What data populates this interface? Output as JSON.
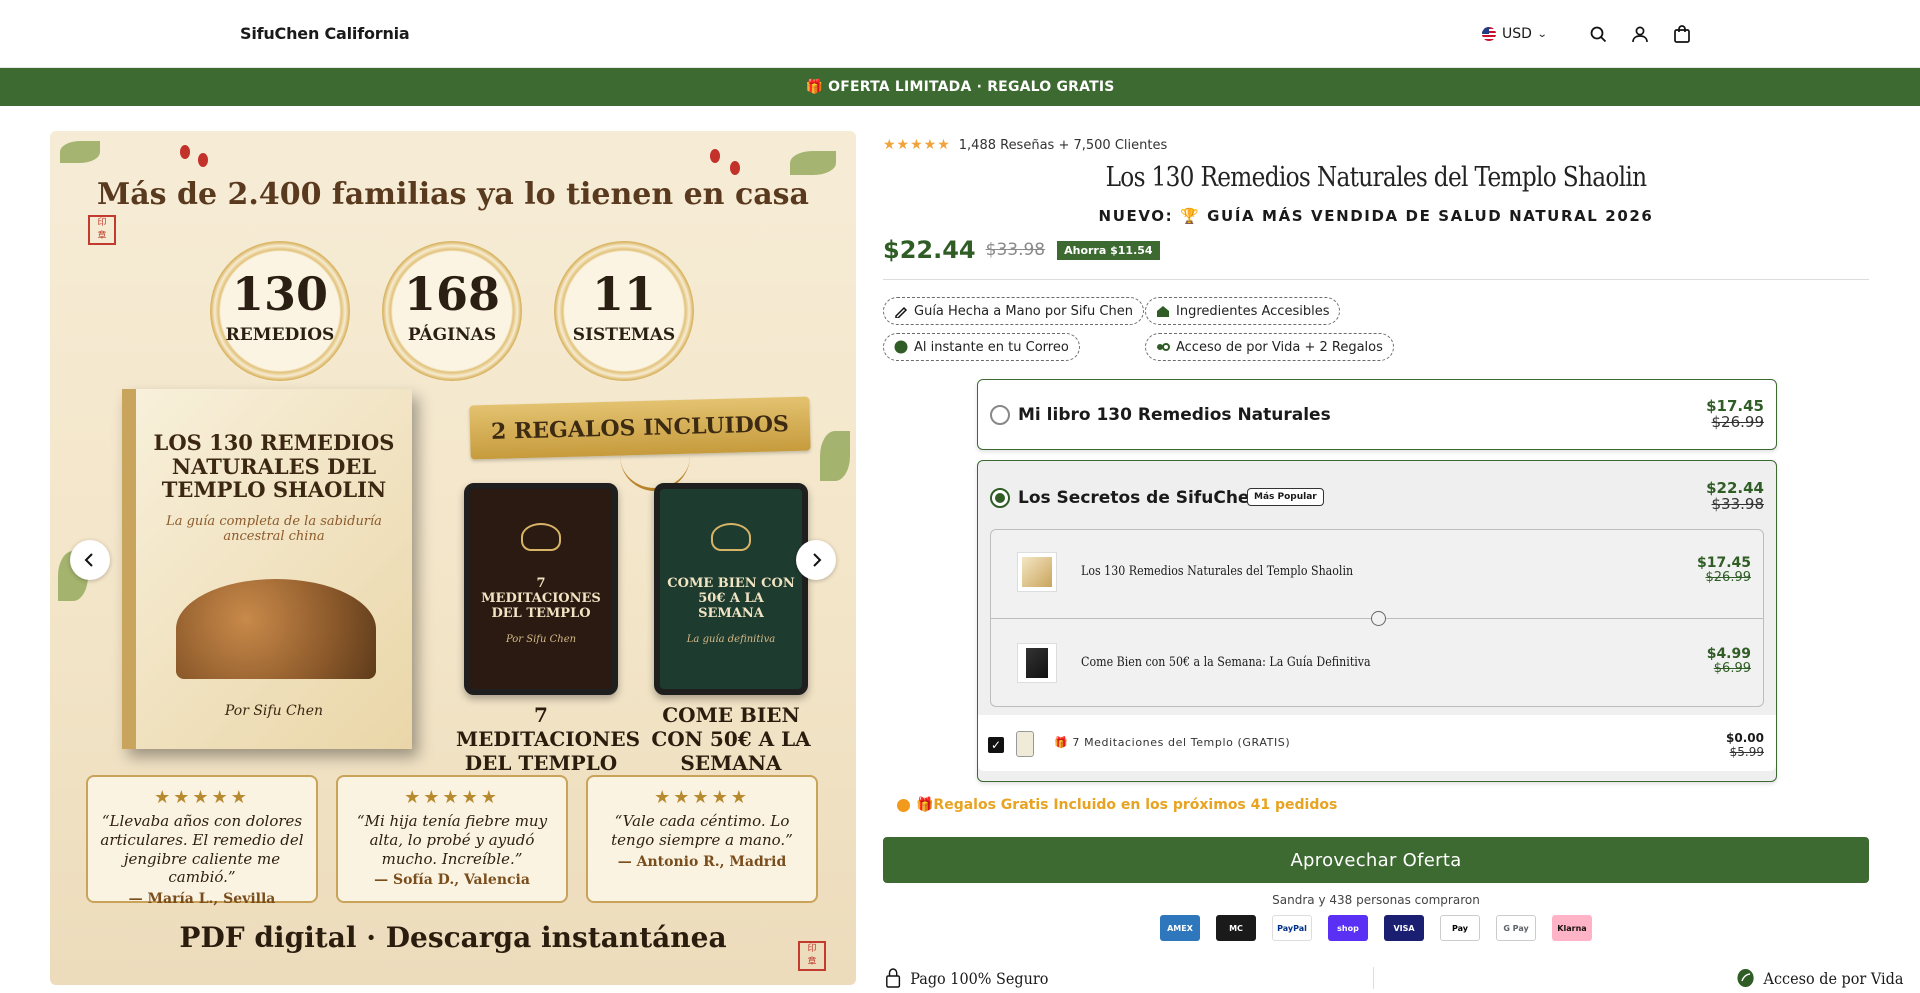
{
  "header": {
    "brand": "SifuChen California",
    "currency": "USD",
    "icons": [
      "flag-us-icon",
      "chevron-down-icon",
      "search-icon",
      "account-icon",
      "bag-icon"
    ]
  },
  "promo": {
    "text": "🎁 OFERTA LIMITADA · REGALO GRATIS"
  },
  "gallery": {
    "headline": "Más de 2.400 familias ya lo tienen en casa",
    "stats": [
      {
        "value": "130",
        "label": "REMEDIOS"
      },
      {
        "value": "168",
        "label": "PÁGINAS"
      },
      {
        "value": "11",
        "label": "SISTEMAS"
      }
    ],
    "ribbon": "2 REGALOS INCLUIDOS",
    "book": {
      "title": "LOS 130 REMEDIOS NATURALES DEL TEMPLO SHAOLIN",
      "subtitle": "La guía completa de la sabiduría ancestral china",
      "author": "Por Sifu Chen"
    },
    "bonus1": {
      "cover_title": "7 MEDITACIONES DEL TEMPLO",
      "cover_author": "Por Sifu Chen",
      "caption": "7 MEDITACIONES DEL TEMPLO"
    },
    "bonus2": {
      "cover_title": "COME BIEN CON 50€ A LA SEMANA",
      "cover_author": "La guía definitiva",
      "caption": "COME BIEN CON 50€ A LA SEMANA"
    },
    "reviews": [
      {
        "stars": "★★★★★",
        "quote": "“Llevaba años con dolores articulares. El remedio del jengibre caliente me cambió.”",
        "author": "— María L., Sevilla"
      },
      {
        "stars": "★★★★★",
        "quote": "“Mi hija tenía fiebre muy alta, lo probé y ayudó mucho. Increíble.”",
        "author": "— Sofía D., Valencia"
      },
      {
        "stars": "★★★★★",
        "quote": "“Vale cada céntimo. Lo tengo siempre a mano.”",
        "author": "— Antonio R., Madrid"
      }
    ],
    "footer": "PDF digital · Descarga instantánea",
    "prev": "‹",
    "next": "›"
  },
  "product": {
    "stars": "★★★★★",
    "rating_text": "1,488 Reseñas + 7,500 Clientes",
    "title": "Los 130 Remedios Naturales del Templo Shaolin",
    "subtitle": "NUEVO: 🏆 GUÍA MÁS VENDIDA DE SALUD NATURAL 2026",
    "price": "$22.44",
    "compare_price": "$33.98",
    "save_badge": "Ahorra $11.54"
  },
  "features": [
    {
      "icon": "pen-icon",
      "label": "Guía Hecha a Mano por Sifu Chen"
    },
    {
      "icon": "home-icon",
      "label": "Ingredientes Accesibles"
    },
    {
      "icon": "mail-icon",
      "label": "Al instante en tu Correo"
    },
    {
      "icon": "infinity-icon",
      "label": "Acceso de por Vida + 2 Regalos"
    }
  ],
  "offers": {
    "option1": {
      "label": "Mi libro 130 Remedios Naturales",
      "price": "$17.45",
      "compare": "$26.99",
      "selected": false
    },
    "option2": {
      "label": "Los Secretos de SifuChen",
      "badge": "Más Popular",
      "price": "$22.44",
      "compare": "$33.98",
      "selected": true,
      "items": [
        {
          "name": "Los 130 Remedios Naturales del Templo Shaolin",
          "price": "$17.45",
          "compare": "$26.99"
        },
        {
          "name": "Come Bien con 50€ a la Semana: La Guía Definitiva",
          "price": "$4.99",
          "compare": "$6.99"
        }
      ],
      "gift": {
        "name": "🎁 7 Meditaciones del Templo (GRATIS)",
        "price": "$0.00",
        "compare": "$5.99",
        "checked": true
      }
    }
  },
  "urgency": "🎁Regalos Gratis Incluido en los próximos 41 pedidos",
  "cta": "Aprovechar Oferta",
  "social_proof": "Sandra y 438 personas compraron",
  "payments": [
    {
      "name": "AMEX",
      "bg": "#2e77bc",
      "fg": "#ffffff"
    },
    {
      "name": "MC",
      "bg": "#1a1a1a",
      "fg": "#ffffff"
    },
    {
      "name": "PayPal",
      "bg": "#ffffff",
      "fg": "#003087"
    },
    {
      "name": "shop",
      "bg": "#5a31f4",
      "fg": "#ffffff"
    },
    {
      "name": "VISA",
      "bg": "#1a1f71",
      "fg": "#ffffff"
    },
    {
      "name": "Pay",
      "bg": "#ffffff",
      "fg": "#000000"
    },
    {
      "name": "G Pay",
      "bg": "#ffffff",
      "fg": "#5f6368"
    },
    {
      "name": "Klarna",
      "bg": "#ffb3c7",
      "fg": "#17120f"
    }
  ],
  "trust": {
    "secure": "Pago 100% Seguro",
    "lifetime": "Acceso de por Vida"
  },
  "colors": {
    "brand_green": "#3d6a31",
    "price_green": "#2f5d25",
    "urgency_orange": "#e8a321",
    "star_orange": "#f2a23a"
  }
}
